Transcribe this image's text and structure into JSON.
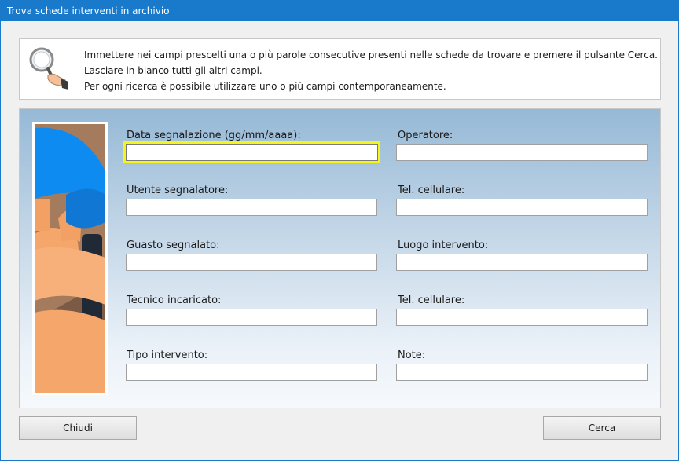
{
  "window": {
    "title": "Trova schede interventi in archivio"
  },
  "info": {
    "lines": [
      "Immettere nei campi prescelti una o più parole consecutive presenti nelle schede da trovare e premere il pulsante Cerca.",
      "Lasciare in bianco tutti gli altri campi.",
      "Per ogni ricerca è possibile utilizzare uno o più campi contemporaneamente."
    ],
    "icon": "magnifier-icon"
  },
  "form": {
    "left": [
      {
        "label": "Data segnalazione (gg/mm/aaaa):",
        "value": ""
      },
      {
        "label": "Utente segnalatore:",
        "value": ""
      },
      {
        "label": "Guasto segnalato:",
        "value": ""
      },
      {
        "label": "Tecnico incaricato:",
        "value": ""
      },
      {
        "label": "Tipo intervento:",
        "value": ""
      }
    ],
    "right": [
      {
        "label": "Operatore:",
        "value": ""
      },
      {
        "label": "Tel. cellulare:",
        "value": ""
      },
      {
        "label": "Luogo intervento:",
        "value": ""
      },
      {
        "label": "Tel. cellulare:",
        "value": ""
      },
      {
        "label": "Note:",
        "value": ""
      }
    ]
  },
  "buttons": {
    "close": "Chiudi",
    "search": "Cerca"
  },
  "colors": {
    "titlebar": "#1979ca",
    "focus": "#f5f519"
  }
}
